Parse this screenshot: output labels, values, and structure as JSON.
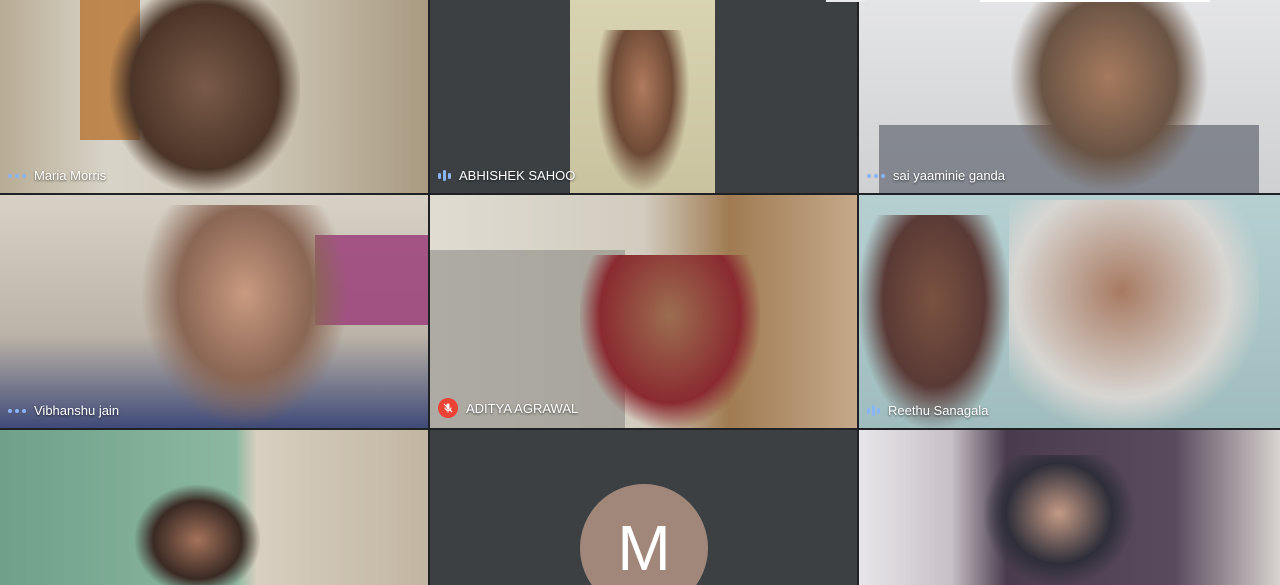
{
  "participants": [
    {
      "name": "Maria Morris",
      "indicator": "dots"
    },
    {
      "name": "ABHISHEK SAHOO",
      "indicator": "bars"
    },
    {
      "name": "sai yaaminie ganda",
      "indicator": "dots"
    },
    {
      "name": "Vibhanshu jain",
      "indicator": "dots"
    },
    {
      "name": "ADITYA AGRAWAL",
      "indicator": "mic-off"
    },
    {
      "name": "Reethu Sanagala",
      "indicator": "bars"
    }
  ],
  "avatar_tile": {
    "initial": "M",
    "color": "#a1877a"
  },
  "colors": {
    "background": "#202124",
    "indicator": "#8ab4f8",
    "mic_off": "#ea4335"
  }
}
